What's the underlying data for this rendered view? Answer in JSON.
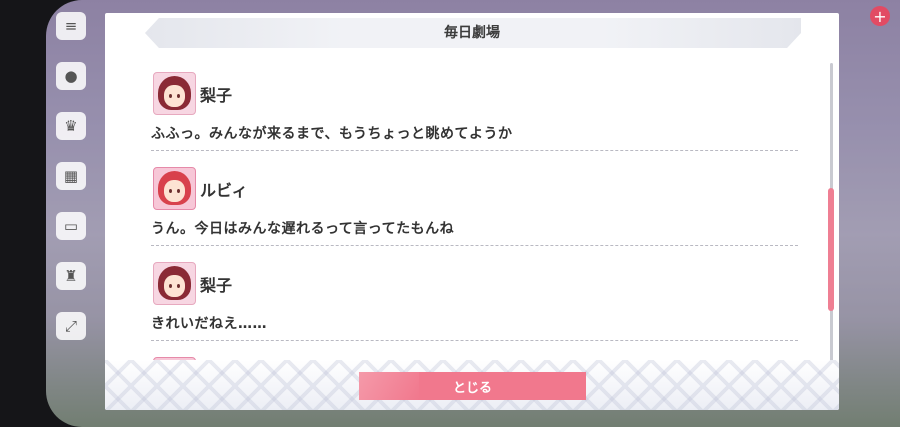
{
  "dialog": {
    "title": "毎日劇場",
    "close_label": "とじる"
  },
  "entries": [
    {
      "speaker": "梨子",
      "avatar": "riko-avatar",
      "text": "ふふっ。みんなが来るまで、もうちょっと眺めてようか"
    },
    {
      "speaker": "ルビィ",
      "avatar": "ruby-avatar",
      "text": "うん。今日はみんな遅れるって言ってたもんね"
    },
    {
      "speaker": "梨子",
      "avatar": "riko-avatar",
      "text": "きれいだねえ……"
    }
  ],
  "colors": {
    "accent": "#f1788d",
    "scroll_thumb": "#ef7f93",
    "title_band": "#eceef3"
  },
  "icons": {
    "menu": "menu-icon",
    "chat": "chat-icon",
    "present": "present-icon",
    "gift": "gift-icon",
    "screen": "screen-icon",
    "trophy": "trophy-icon",
    "expand": "expand-icon",
    "badge_plus": "plus-icon"
  }
}
